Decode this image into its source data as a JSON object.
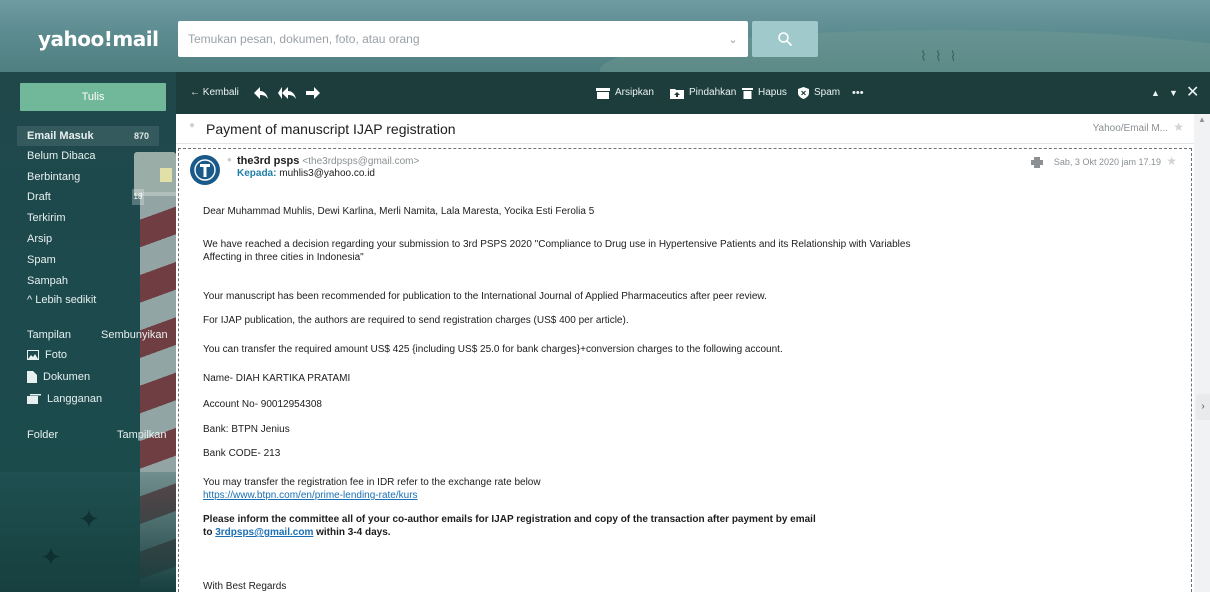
{
  "header": {
    "logo": "yahoo!mail",
    "search_placeholder": "Temukan pesan, dokumen, foto, atau orang"
  },
  "sidebar": {
    "compose_label": "Tulis",
    "folders": [
      {
        "label": "Email Masuk",
        "count": "870"
      },
      {
        "label": "Belum Dibaca"
      },
      {
        "label": "Berbintang"
      },
      {
        "label": "Draft",
        "count": "18"
      },
      {
        "label": "Terkirim"
      },
      {
        "label": "Arsip"
      },
      {
        "label": "Spam"
      },
      {
        "label": "Sampah"
      }
    ],
    "less_label": "^ Lebih sedikit",
    "views_label": "Tampilan",
    "views_action": "Sembunyikan",
    "views": [
      {
        "label": "Foto",
        "icon": "image-icon"
      },
      {
        "label": "Dokumen",
        "icon": "document-icon"
      },
      {
        "label": "Langganan",
        "icon": "subscriptions-icon"
      }
    ],
    "folder_label": "Folder",
    "folder_action": "Tampilkan"
  },
  "toolbar": {
    "back_label": "← Kembali",
    "archive_label": "Arsipkan",
    "move_label": "Pindahkan",
    "delete_label": "Hapus",
    "spam_label": "Spam",
    "more_label": "•••"
  },
  "message": {
    "subject": "Payment of manuscript IJAP registration",
    "folder_label": "Yahoo/Email M...",
    "sender_name": "the3rd psps",
    "sender_email": "<the3rdpsps@gmail.com>",
    "to_label": "Kepada:",
    "to_address": "muhlis3@yahoo.co.id",
    "date": "Sab, 3 Okt 2020 jam 17.19",
    "body": {
      "greeting": "Dear Muhammad Muhlis, Dewi Karlina, Merli Namita, Lala Maresta, Yocika Esti Ferolia 5",
      "decision_1": "We have reached a decision regarding your submission to 3rd PSPS 2020 \"Compliance to Drug use in Hypertensive Patients and its Relationship with Variables",
      "decision_2": "Affecting in three cities in Indonesia\"",
      "recommended": "Your manuscript has been recommended for publication to the International Journal of Applied Pharmaceutics after peer review.",
      "charges": "For IJAP publication, the authors are required to send registration charges (US$ 400 per article).",
      "transfer": "You can transfer the required amount US$ 425 {including US$ 25.0 for bank charges}+conversion charges to the following account.",
      "name": "Name- DIAH KARTIKA PRATAMI",
      "account": "Account No- 90012954308",
      "bank": "Bank: BTPN Jenius",
      "bank_code": "Bank CODE- 213",
      "idr": "You may transfer the registration fee in IDR refer to the exchange rate below",
      "link": "https://www.btpn.com/en/prime-lending-rate/kurs",
      "inform_1": "Please inform the committee all of your co-author emails for IJAP registration and copy of the transaction after payment by email",
      "inform_2_prefix": "to ",
      "inform_email": "3rdpsps@gmail.com",
      "inform_2_suffix": " within 3-4 days.",
      "regards": "With Best Regards"
    }
  },
  "colors": {
    "header": "#5e8d92",
    "sidebar": "#1c4a4d",
    "toolbar": "#1d3d3d",
    "compose": "#71b79a",
    "link": "#1a6fb3"
  }
}
